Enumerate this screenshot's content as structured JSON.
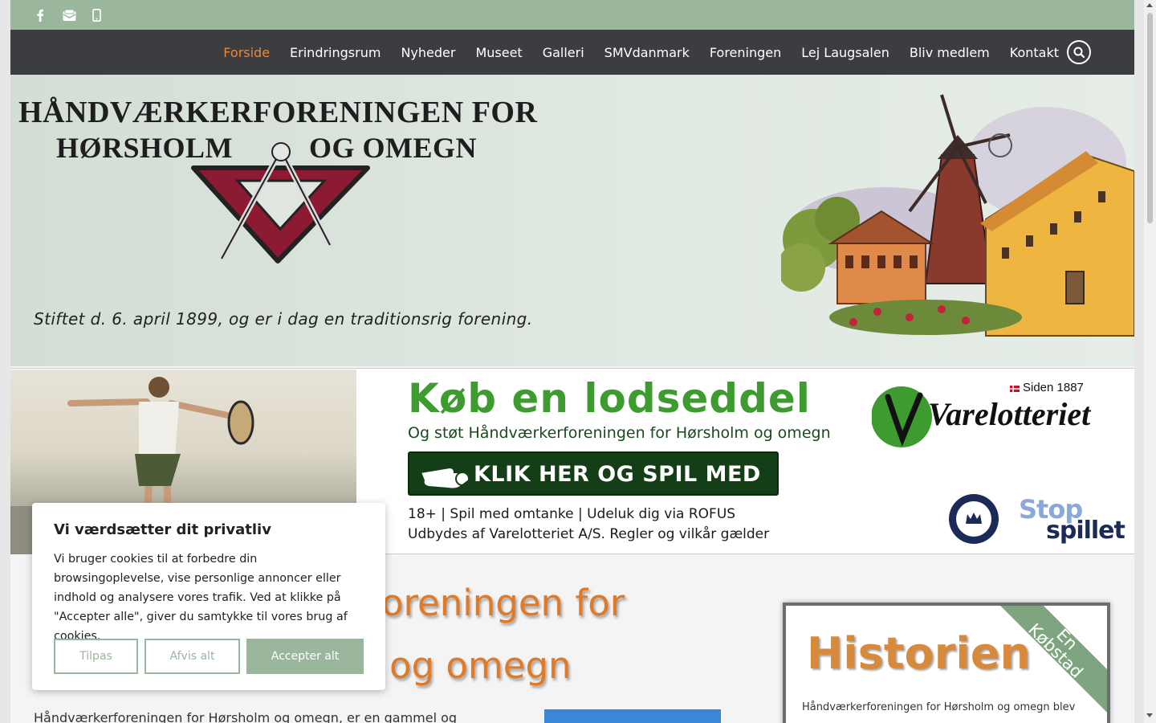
{
  "topbar": {
    "social": [
      {
        "name": "facebook-icon"
      },
      {
        "name": "email-icon"
      },
      {
        "name": "phone-icon"
      }
    ]
  },
  "nav": {
    "items": [
      "Forside",
      "Erindringsrum",
      "Nyheder",
      "Museet",
      "Galleri",
      "SMVdanmark",
      "Foreningen",
      "Lej Laugsalen",
      "Bliv medlem",
      "Kontakt"
    ],
    "active": "Forside"
  },
  "header": {
    "logo_line1": "HÅNDVÆRKERFORENINGEN FOR",
    "logo_line2a": "HØRSHOLM",
    "logo_line2b": "OG OMEGN",
    "tagline": "Stiftet d. 6. april 1899, og er i dag en traditionsrig forening."
  },
  "banner": {
    "title": "Køb en lodseddel",
    "subtitle": "Og støt Håndværkerforeningen for Hørsholm og omegn",
    "cta": "KLIK HER OG SPIL MED",
    "line1": "18+ | Spil med omtanke | Udeluk dig via ROFUS",
    "line2": "Udbydes af Varelotteriet A/S. Regler og vilkår gælder",
    "brand": "Varelotteriet",
    "since": "Siden 1887",
    "stop_line1": "Stop",
    "stop_line2": "spillet"
  },
  "main": {
    "title_line1": "oreningen for",
    "title_line2": "og omegn",
    "intro": "Håndværkerforeningen for Hørsholm og omegn, er en gammel og"
  },
  "historien": {
    "heading": "Historien",
    "ribbon_line1": "En",
    "ribbon_line2": "Købstad",
    "text": "Håndværkerforeningen for Hørsholm og omegn blev"
  },
  "cookie": {
    "title": "Vi værdsætter dit privatliv",
    "body": "Vi bruger cookies til at forbedre din browsingoplevelse, vise personlige annoncer eller indhold og analysere vores trafik. Ved at klikke på \"Accepter alle\", giver du samtykke til vores brug af cookies.",
    "btn_customize": "Tilpas",
    "btn_reject": "Afvis alt",
    "btn_accept": "Accepter alt"
  },
  "colors": {
    "accent": "#e8893b",
    "topbar": "#9ab69d",
    "nav": "#3b3d40",
    "cookie_accent": "#9ab69d"
  }
}
